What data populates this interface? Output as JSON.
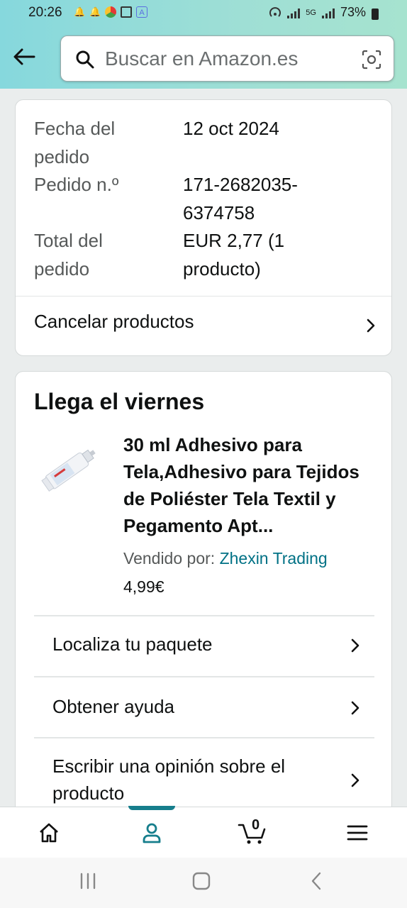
{
  "status_bar": {
    "time": "20:26",
    "battery": "73%",
    "network": "5G"
  },
  "header": {
    "search_placeholder": "Buscar en Amazon.es"
  },
  "order_summary": {
    "rows": [
      {
        "label": "Fecha del pedido",
        "label_lines": [
          "Fecha del",
          "pedido"
        ],
        "value_lines": [
          "12 oct 2024"
        ]
      },
      {
        "label": "Pedido n.º",
        "label_lines": [
          "Pedido n.º"
        ],
        "value_lines": [
          "171-2682035-",
          "6374758"
        ]
      },
      {
        "label": "Total del pedido",
        "label_lines": [
          "Total del",
          "pedido"
        ],
        "value_lines": [
          "EUR 2,77 (1",
          "producto)"
        ]
      }
    ],
    "cancel_label": "Cancelar productos"
  },
  "shipment": {
    "arrival": "Llega el viernes",
    "product_title": "30 ml Adhesivo para Tela,Adhesivo para Tejidos de Poliéster Tela Textil y Pegamento Apt...",
    "seller_prefix": "Vendido por:",
    "seller_name": "Zhexin Trading",
    "price": "4,99€",
    "actions": [
      {
        "label": "Localiza tu paquete"
      },
      {
        "label": "Obtener ayuda"
      },
      {
        "label": "Escribir una opinión sobre el producto"
      }
    ]
  },
  "bottom_nav": {
    "items": [
      "home-icon",
      "account-icon",
      "cart-icon",
      "menu-icon"
    ],
    "cart_count": "0",
    "active": "account"
  },
  "colors": {
    "accent": "#167e8c",
    "link": "#007185",
    "header_bg": "#8edbd8"
  }
}
